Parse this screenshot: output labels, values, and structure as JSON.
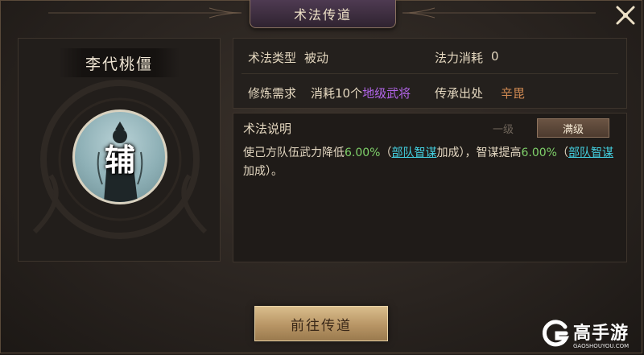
{
  "window": {
    "title": "术法传道",
    "close_icon": "close-icon"
  },
  "character": {
    "name": "李代桃僵",
    "portrait_badge": "辅"
  },
  "info": {
    "type_label": "术法类型",
    "type_value": "被动",
    "cost_label": "法力消耗",
    "cost_value": "0",
    "requirement_label": "修炼需求",
    "requirement_prefix": "消耗10个",
    "requirement_highlight": "地级武将",
    "origin_label": "传承出处",
    "origin_value": "辛毘"
  },
  "description": {
    "header": "术法说明",
    "tabs": {
      "level1": "一级",
      "full": "满级",
      "selected": "满级"
    },
    "text_parts": {
      "p1": "使己方队伍武力降低",
      "v1": "6.00%",
      "p2": "（",
      "link1": "部队智谋",
      "p3": "加成），智谋提高",
      "v2": "6.00%",
      "p4": "（",
      "link2": "部队智谋",
      "p5": "加成）。"
    }
  },
  "actions": {
    "go_button": "前往传道"
  },
  "watermark": {
    "name": "高手游",
    "domain": "GAOSHOUYOU.COM"
  },
  "colors": {
    "highlight_purple": "#b265e8",
    "origin_orange": "#d18a52",
    "value_green": "#7fd16a",
    "link_cyan": "#43d0e0"
  }
}
